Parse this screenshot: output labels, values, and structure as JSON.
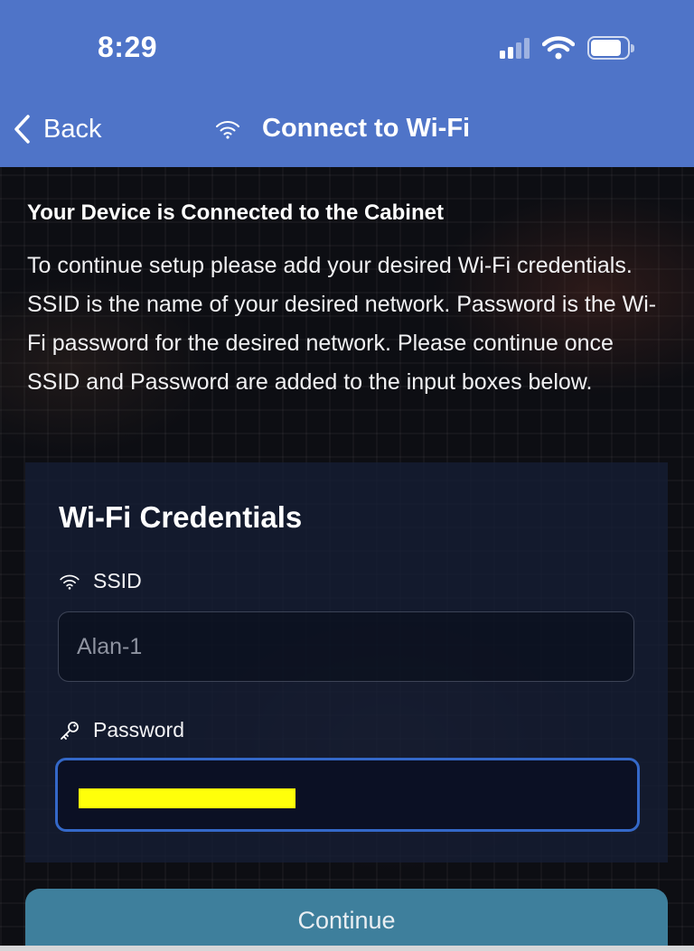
{
  "status_bar": {
    "time": "8:29",
    "icons": [
      "cellular-signal-icon",
      "wifi-icon",
      "battery-icon"
    ]
  },
  "nav": {
    "back_label": "Back",
    "title": "Connect to Wi-Fi",
    "title_icon": "wifi-icon"
  },
  "intro": {
    "title": "Your Device is Connected to the Cabinet",
    "body": "To continue setup please add your desired Wi-Fi credentials. SSID is the name of your desired network. Password is the Wi-Fi password for the desired network. Please continue once SSID and Password are added to the input boxes below."
  },
  "credentials": {
    "title": "Wi-Fi Credentials",
    "ssid": {
      "label": "SSID",
      "icon": "wifi-icon",
      "placeholder": "Alan-1",
      "value": ""
    },
    "password": {
      "label": "Password",
      "icon": "key-icon",
      "value": "",
      "redacted": true
    }
  },
  "actions": {
    "continue_label": "Continue"
  },
  "colors": {
    "header": "#4f74c8",
    "button": "#3e7f9c",
    "focus_border": "#3468c8",
    "redaction": "#ffff0a"
  }
}
